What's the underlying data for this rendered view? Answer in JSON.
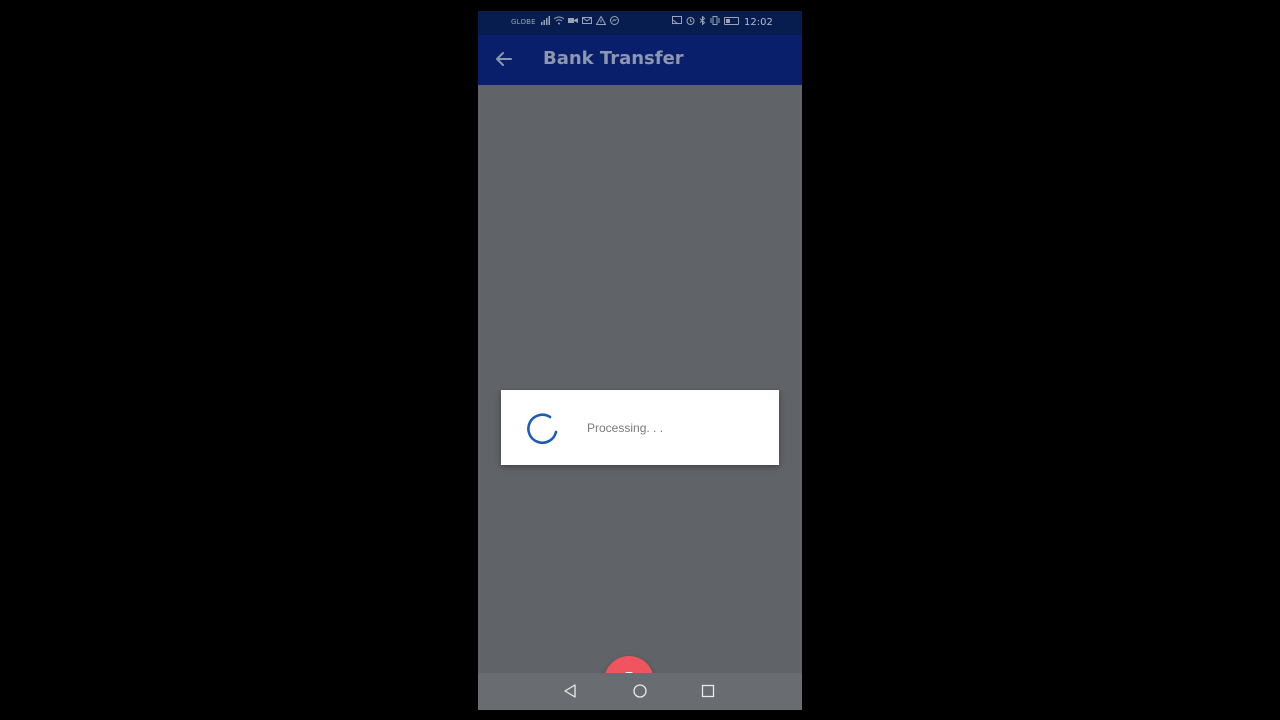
{
  "status_bar": {
    "carrier": "GLOBE",
    "time": "12:02",
    "left_icons": [
      "signal-icon",
      "wifi-icon",
      "video-icon",
      "mail-icon",
      "warning-icon",
      "messenger-icon"
    ],
    "right_icons": [
      "cast-icon",
      "alarm-icon",
      "bluetooth-icon",
      "vibrate-icon",
      "battery-icon"
    ]
  },
  "app_bar": {
    "title": "Bank Transfer",
    "back_icon": "arrow-back-icon",
    "background": "#0a1f6b"
  },
  "dialog": {
    "message": "Processing. . .",
    "spinner_color": "#1e5bb8"
  },
  "fab": {
    "icon": "camera-icon",
    "color": "#f0545e"
  },
  "nav_bar": {
    "icons": [
      "nav-back-icon",
      "nav-home-icon",
      "nav-recents-icon"
    ]
  }
}
